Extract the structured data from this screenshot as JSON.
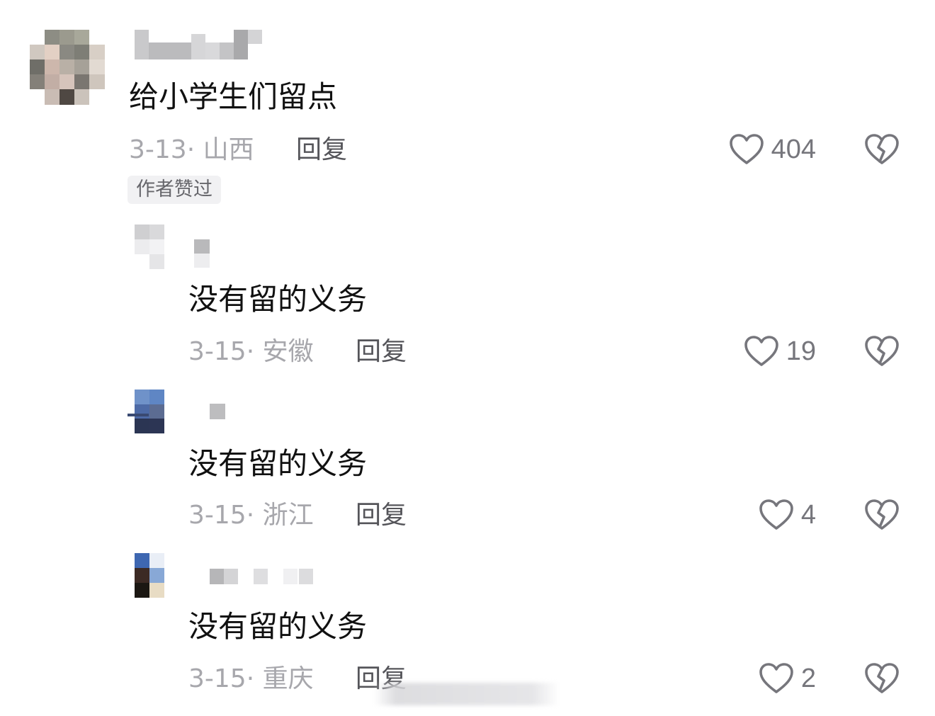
{
  "comments": [
    {
      "text": "给小学生们留点",
      "date": "3-13",
      "separator": "·",
      "location": "山西",
      "reply_label": "回复",
      "likes": "404",
      "badge": "作者赞过"
    },
    {
      "text": "没有留的义务",
      "date": "3-15",
      "separator": "·",
      "location": "安徽",
      "reply_label": "回复",
      "likes": "19"
    },
    {
      "text": "没有留的义务",
      "date": "3-15",
      "separator": "·",
      "location": "浙江",
      "reply_label": "回复",
      "likes": "4"
    },
    {
      "text": "没有留的义务",
      "date": "3-15",
      "separator": "·",
      "location": "重庆",
      "reply_label": "回复",
      "likes": "2"
    }
  ],
  "icons": {
    "like": "heart-outline-icon",
    "dislike": "broken-heart-icon"
  },
  "colors": {
    "text": "#111111",
    "meta": "#a7a7ac",
    "icon": "#76767c"
  }
}
